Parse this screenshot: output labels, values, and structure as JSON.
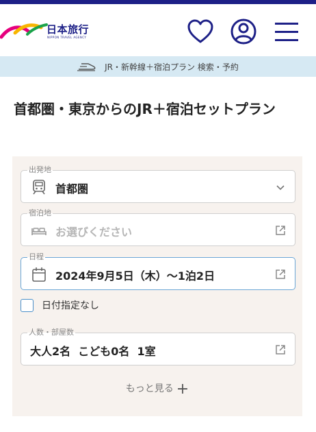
{
  "header": {
    "logo_text": "日本旅行",
    "logo_sub": "NIPPON TRAVEL AGENCY",
    "icons": [
      "heart-icon",
      "user-icon",
      "hamburger-menu-icon"
    ],
    "brand_color": "#1d2087"
  },
  "subbar": {
    "text": "JR・新幹線＋宿泊プラン 検索・予約",
    "icon": "shinkansen-icon",
    "bg_color": "#d6e9f3"
  },
  "page_title": "首都圏・東京からのJR＋宿泊セットプラン",
  "form": {
    "departure": {
      "label": "出発地",
      "value": "首都圏",
      "icon": "train-icon"
    },
    "stay": {
      "label": "宿泊地",
      "placeholder": "お選びください",
      "icon": "bed-icon"
    },
    "date": {
      "label": "日程",
      "value": "2024年9月5日（木）～1泊2日",
      "icon": "calendar-icon"
    },
    "no_date": {
      "label": "日付指定なし",
      "checked": false
    },
    "people": {
      "label": "人数・部屋数",
      "value": "大人2名  こども0名  1室"
    },
    "more_label": "もっと見る"
  }
}
